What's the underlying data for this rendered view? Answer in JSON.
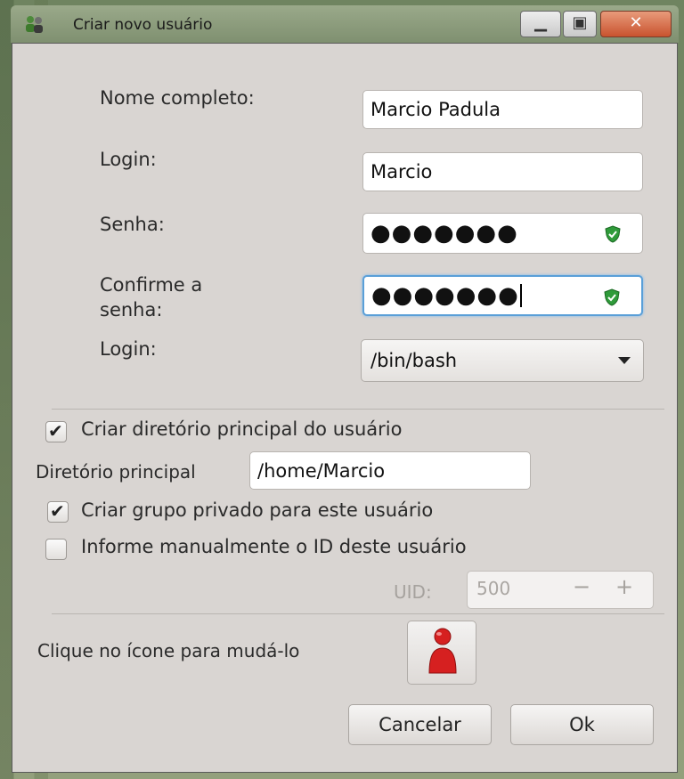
{
  "window": {
    "title": "Criar novo usuário"
  },
  "form": {
    "full_name_label": "Nome completo:",
    "full_name_value": "Marcio Padula",
    "login_label": "Login:",
    "login_value": "Marcio",
    "password_label": "Senha:",
    "password_value": "●●●●●●●",
    "confirm_label_line1": "Confirme a",
    "confirm_label_line2": "senha:",
    "confirm_value": "●●●●●●●",
    "shell_label": "Login:",
    "shell_value": "/bin/bash"
  },
  "options": {
    "create_home_label": "Criar diretório principal do usuário",
    "create_home_checked": true,
    "home_dir_label": "Diretório principal",
    "home_dir_value": "/home/Marcio",
    "private_group_label": "Criar grupo privado para este usuário",
    "private_group_checked": true,
    "manual_uid_label": "Informe manualmente o ID deste usuário",
    "manual_uid_checked": false,
    "uid_label": "UID:",
    "uid_value": "500"
  },
  "icon_section": {
    "label": "Clique no ícone para mudá-lo"
  },
  "buttons": {
    "cancel": "Cancelar",
    "ok": "Ok"
  },
  "colors": {
    "focus_border": "#5a9fd8",
    "shield_green": "#2f9b3a",
    "avatar_red": "#d62020"
  }
}
